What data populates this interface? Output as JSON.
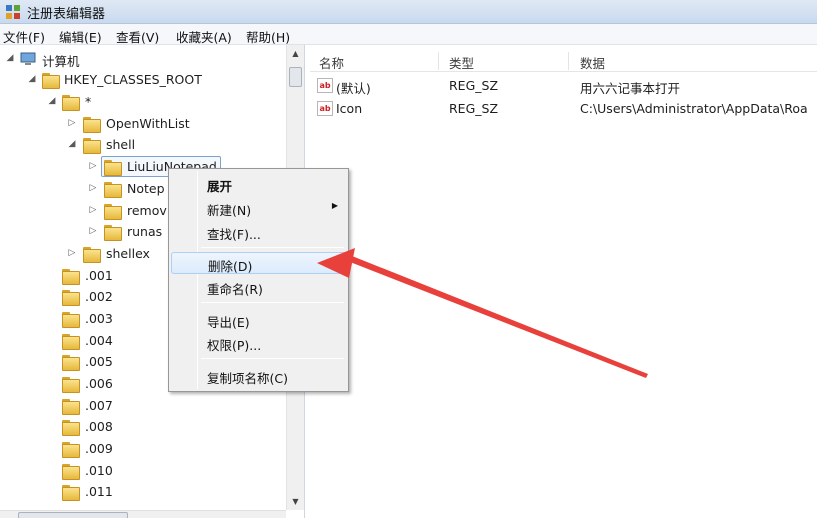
{
  "window": {
    "title": "注册表编辑器"
  },
  "menu": [
    "文件(F)",
    "编辑(E)",
    "查看(V)",
    "收藏夹(A)",
    "帮助(H)"
  ],
  "tree": {
    "computer": "计算机",
    "root": "HKEY_CLASSES_ROOT",
    "star": "*",
    "openwithlist": "OpenWithList",
    "shell": "shell",
    "shell_children": [
      "LiuLiuNotepad",
      "Notep",
      "remov",
      "runas"
    ],
    "shellex": "shellex",
    "extensions": [
      ".001",
      ".002",
      ".003",
      ".004",
      ".005",
      ".006",
      ".007",
      ".008",
      ".009",
      ".010",
      ".011"
    ]
  },
  "list": {
    "headers": {
      "name": "名称",
      "type": "类型",
      "data": "数据"
    },
    "rows": [
      {
        "name": "(默认)",
        "type": "REG_SZ",
        "data": "用六六记事本打开",
        "icon": "ab"
      },
      {
        "name": "Icon",
        "type": "REG_SZ",
        "data": "C:\\Users\\Administrator\\AppData\\Roa",
        "icon": "ab"
      }
    ]
  },
  "context_menu": {
    "expand": "展开",
    "new": "新建(N)",
    "find": "查找(F)...",
    "delete": "删除(D)",
    "rename": "重命名(R)",
    "export": "导出(E)",
    "permissions": "权限(P)...",
    "copy_key_name": "复制项名称(C)"
  },
  "colors": {
    "annotation_arrow": "#e8413b",
    "hover_highlight": "#dcebfc",
    "selection_border": "#7da2ce"
  }
}
